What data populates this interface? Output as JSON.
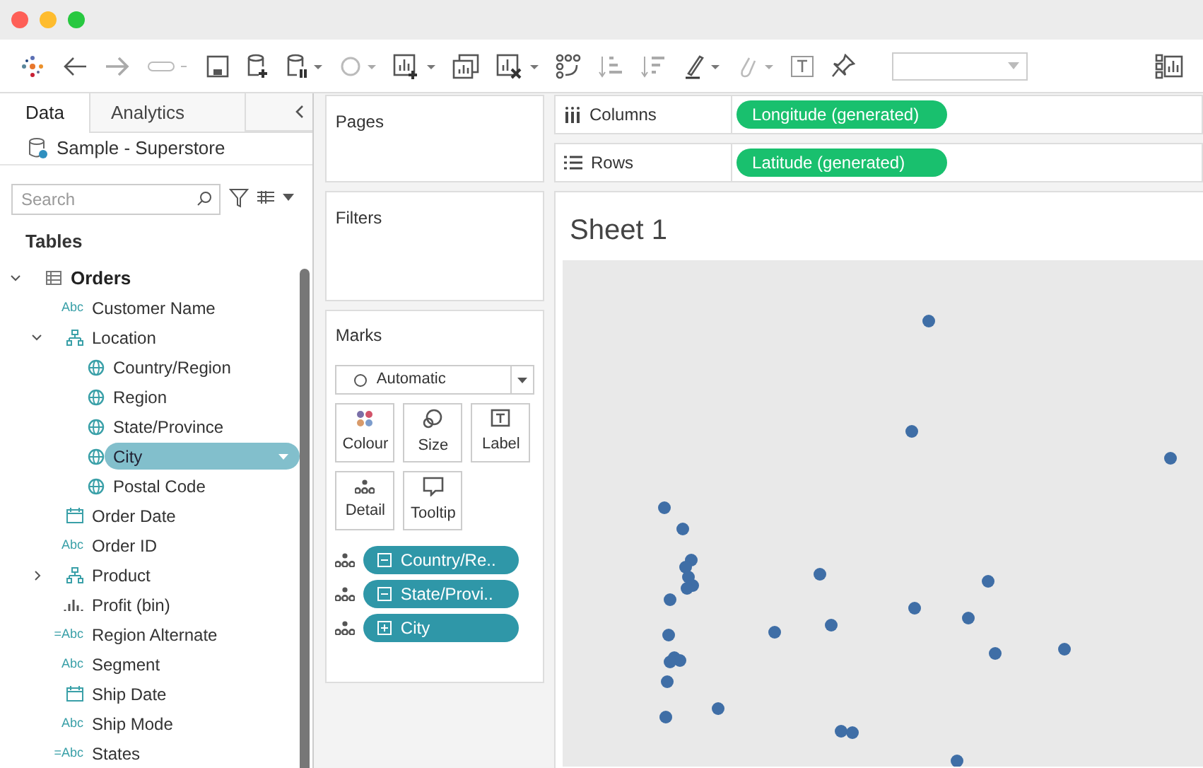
{
  "side_tabs": [
    {
      "label": "Data",
      "selected": true
    },
    {
      "label": "Analytics",
      "selected": false
    }
  ],
  "data_source": "Sample - Superstore",
  "search": {
    "placeholder": "Search"
  },
  "tables_heading": "Tables",
  "tree": [
    {
      "label": "Orders",
      "kind": "table",
      "expanded": true,
      "selected": false,
      "children": [
        {
          "label": "Customer Name",
          "kind": "text",
          "badge": "Abc",
          "selected": false
        },
        {
          "label": "Location",
          "kind": "hierarchy",
          "expanded": true,
          "selected": false,
          "children": [
            {
              "label": "Country/Region",
              "kind": "geo",
              "selected": false
            },
            {
              "label": "Region",
              "kind": "geo",
              "selected": false
            },
            {
              "label": "State/Province",
              "kind": "geo",
              "selected": false
            },
            {
              "label": "City",
              "kind": "geo",
              "selected": true
            },
            {
              "label": "Postal Code",
              "kind": "geo",
              "selected": false
            }
          ]
        },
        {
          "label": "Order Date",
          "kind": "date",
          "selected": false
        },
        {
          "label": "Order ID",
          "kind": "text",
          "badge": "Abc",
          "selected": false
        },
        {
          "label": "Product",
          "kind": "hierarchy",
          "expanded": false,
          "selected": false
        },
        {
          "label": "Profit (bin)",
          "kind": "bin",
          "selected": false
        },
        {
          "label": "Region Alternate",
          "kind": "text",
          "badge": "=Abc",
          "selected": false
        },
        {
          "label": "Segment",
          "kind": "text",
          "badge": "Abc",
          "selected": false
        },
        {
          "label": "Ship Date",
          "kind": "date",
          "selected": false
        },
        {
          "label": "Ship Mode",
          "kind": "text",
          "badge": "Abc",
          "selected": false
        },
        {
          "label": "States",
          "kind": "text",
          "badge": "=Abc",
          "selected": false
        }
      ]
    }
  ],
  "pages": {
    "title": "Pages"
  },
  "filters": {
    "title": "Filters"
  },
  "marks": {
    "title": "Marks",
    "mark_type": "Automatic",
    "buttons": [
      {
        "label": "Colour",
        "kind": "colour"
      },
      {
        "label": "Size",
        "kind": "size"
      },
      {
        "label": "Label",
        "kind": "label"
      },
      {
        "label": "Detail",
        "kind": "detail"
      },
      {
        "label": "Tooltip",
        "kind": "tooltip"
      }
    ],
    "pills": [
      {
        "label": "Country/Re..",
        "expanded": true
      },
      {
        "label": "State/Provi..",
        "expanded": true
      },
      {
        "label": "City",
        "expanded": false
      }
    ]
  },
  "shelves": [
    {
      "label": "Columns",
      "kind": "columns",
      "pill": "Longitude (generated)"
    },
    {
      "label": "Rows",
      "kind": "rows",
      "pill": "Latitude (generated)"
    }
  ],
  "sheet": {
    "title": "Sheet 1"
  }
}
